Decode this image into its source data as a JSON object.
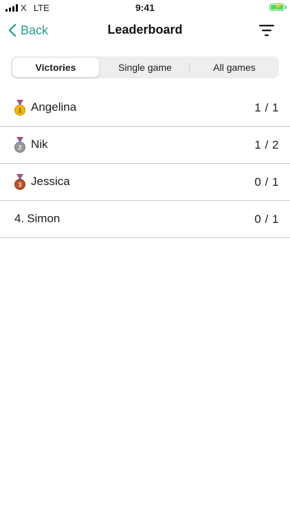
{
  "status_bar": {
    "carrier": "X",
    "network": "LTE",
    "time": "9:41"
  },
  "nav": {
    "back_label": "Back",
    "title": "Leaderboard"
  },
  "tabs": [
    {
      "label": "Victories",
      "active": true
    },
    {
      "label": "Single game",
      "active": false
    },
    {
      "label": "All games",
      "active": false
    }
  ],
  "leaderboard": [
    {
      "rank": "",
      "medal": "gold-medal-icon",
      "name": "Angelina",
      "score": "1 / 1"
    },
    {
      "rank": "",
      "medal": "silver-medal-icon",
      "name": "Nik",
      "score": "1 / 2"
    },
    {
      "rank": "",
      "medal": "bronze-medal-icon",
      "name": "Jessica",
      "score": "0 / 1"
    },
    {
      "rank": "4.",
      "medal": "",
      "name": "Simon",
      "score": "0 / 1"
    }
  ],
  "colors": {
    "accent": "#2a9d8f",
    "gold": "#f2b705",
    "silver": "#9a9a9a",
    "bronze": "#b5532a",
    "battery": "#4cd964"
  }
}
